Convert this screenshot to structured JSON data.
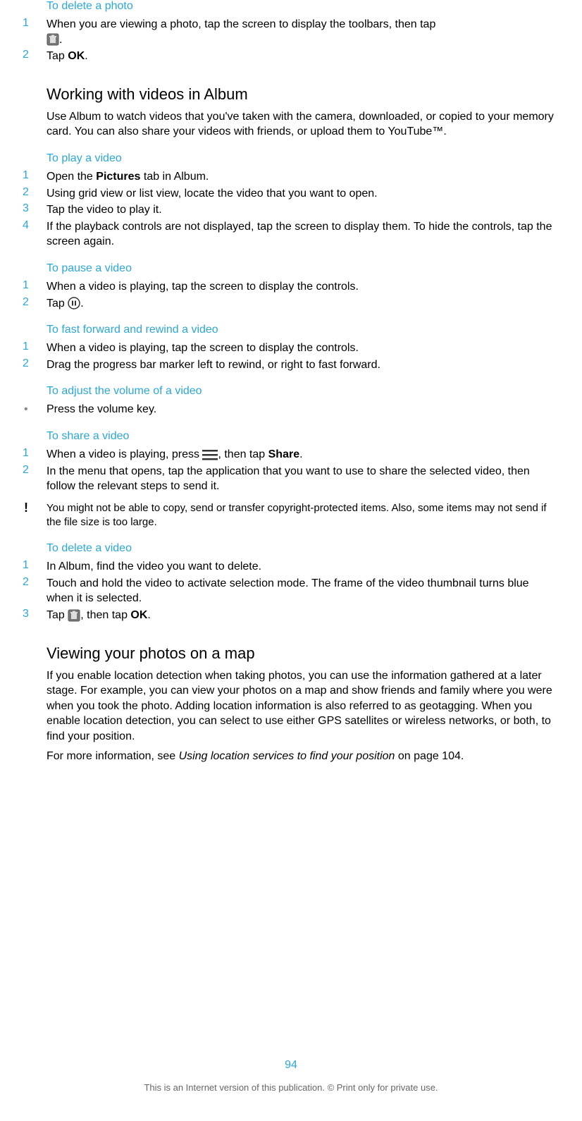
{
  "sec_delete_photo": {
    "heading": "To delete a photo",
    "step1_a": "When you are viewing a photo, tap the screen to display the toolbars, then tap ",
    "step1_b": ".",
    "step2_a": "Tap ",
    "step2_ok": "OK",
    "step2_b": "."
  },
  "sec_videos": {
    "heading": "Working with videos in Album",
    "para": "Use Album to watch videos that you've taken with the camera, downloaded, or copied to your memory card. You can also share your videos with friends, or upload them to YouTube™."
  },
  "sec_play": {
    "heading": "To play a video",
    "s1_a": "Open the ",
    "s1_pictures": "Pictures",
    "s1_b": " tab in Album.",
    "s2": "Using grid view or list view, locate the video that you want to open.",
    "s3": "Tap the video to play it.",
    "s4": "If the playback controls are not displayed, tap the screen to display them. To hide the controls, tap the screen again."
  },
  "sec_pause": {
    "heading": "To pause a video",
    "s1": "When a video is playing, tap the screen to display the controls.",
    "s2_a": "Tap ",
    "s2_b": "."
  },
  "sec_ff": {
    "heading": "To fast forward and rewind a video",
    "s1": "When a video is playing, tap the screen to display the controls.",
    "s2": "Drag the progress bar marker left to rewind, or right to fast forward."
  },
  "sec_volume": {
    "heading": "To adjust the volume of a video",
    "s1": "Press the volume key."
  },
  "sec_share": {
    "heading": "To share a video",
    "s1_a": "When a video is playing, press ",
    "s1_b": ", then tap ",
    "s1_share": "Share",
    "s1_c": ".",
    "s2": "In the menu that opens, tap the application that you want to use to share the selected video, then follow the relevant steps to send it.",
    "note": "You might not be able to copy, send or transfer copyright-protected items. Also, some items may not send if the file size is too large."
  },
  "sec_delete_video": {
    "heading": "To delete a video",
    "s1": "In Album, find the video you want to delete.",
    "s2": "Touch and hold the video to activate selection mode. The frame of the video thumbnail turns blue when it is selected.",
    "s3_a": "Tap ",
    "s3_b": ", then tap ",
    "s3_ok": "OK",
    "s3_c": "."
  },
  "sec_map": {
    "heading": "Viewing your photos on a map",
    "para1": "If you enable location detection when taking photos, you can use the information gathered at a later stage. For example, you can view your photos on a map and show friends and family where you were when you took the photo. Adding location information is also referred to as geotagging. When you enable location detection, you can select to use either GPS satellites or wireless networks, or both, to find your position.",
    "para2_a": "For more information, see ",
    "para2_i": "Using location services to find your position",
    "para2_b": " on page 104."
  },
  "nums": {
    "n1": "1",
    "n2": "2",
    "n3": "3",
    "n4": "4"
  },
  "bullet": "•",
  "bang": "!",
  "page_number": "94",
  "footer": "This is an Internet version of this publication. © Print only for private use."
}
